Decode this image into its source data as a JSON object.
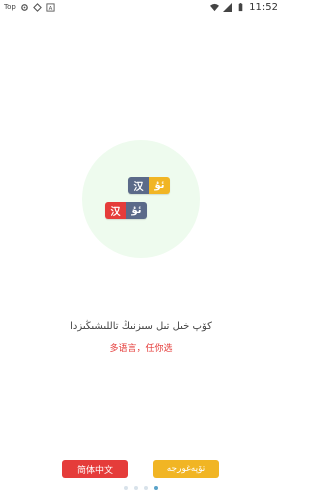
{
  "status_bar": {
    "app_label": "Top",
    "time": "11:52",
    "icons": [
      "app-icon",
      "gear-icon",
      "notification-icon",
      "a-icon",
      "wifi-icon",
      "signal-icon",
      "battery-icon"
    ]
  },
  "illustration": {
    "tag1_left": "汉",
    "tag1_right": "ئۇ",
    "tag2_left": "汉",
    "tag2_right": "ئۇ"
  },
  "text": {
    "uyghur": "كۆپ خىل تىل سىزنىڭ تاللىشىڭىزدا",
    "chinese": "多语言，任你选"
  },
  "buttons": {
    "chinese_label": "简体中文",
    "uyghur_label": "تۆپەغورجە"
  },
  "pagination": {
    "count": 4,
    "active_index": 3
  },
  "colors": {
    "red": "#e53c3a",
    "gold": "#f1b524",
    "navy": "#5b6a89",
    "circle": "#eefbee"
  }
}
